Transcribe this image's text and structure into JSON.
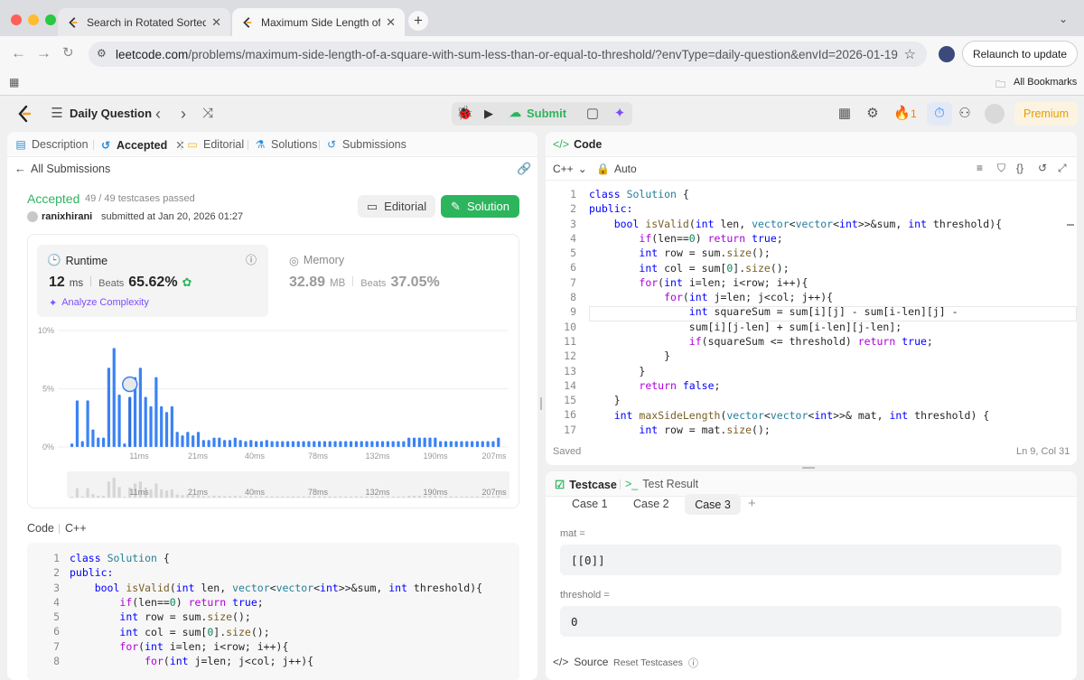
{
  "browser": {
    "tabs": [
      {
        "title": "Search in Rotated Sorted Arra"
      },
      {
        "title": "Maximum Side Length of a Sq"
      }
    ],
    "url_domain": "leetcode.com",
    "url_path": "/problems/maximum-side-length-of-a-square-with-sum-less-than-or-equal-to-threshold/?envType=daily-question&envId=2026-01-19",
    "relaunch_label": "Relaunch to update",
    "bookmarks_label": "All Bookmarks"
  },
  "topbar": {
    "title": "Daily Question",
    "submit_label": "Submit",
    "streak_count": "1",
    "premium_label": "Premium"
  },
  "left": {
    "tabs": [
      "Description",
      "Accepted",
      "Editorial",
      "Solutions",
      "Submissions"
    ],
    "back_label": "All Submissions",
    "status": "Accepted",
    "testcases": "49 / 49 testcases passed",
    "user": "ranixhirani",
    "submitted_at": "submitted at Jan 20, 2026 01:27",
    "editorial_btn": "Editorial",
    "solution_btn": "Solution",
    "runtime_label": "Runtime",
    "runtime_value": "12",
    "runtime_unit": "ms",
    "beats_label": "Beats",
    "runtime_beats": "65.62%",
    "analyze_label": "Analyze Complexity",
    "memory_label": "Memory",
    "memory_value": "32.89",
    "memory_unit": "MB",
    "memory_beats": "37.05%",
    "code_label": "Code",
    "lang_label": "C++"
  },
  "chart_data": {
    "type": "bar",
    "ylabel_ticks": [
      "10%",
      "5%",
      "0%"
    ],
    "ylim": [
      0,
      10
    ],
    "x_tick_labels": [
      "11ms",
      "21ms",
      "40ms",
      "78ms",
      "132ms",
      "190ms",
      "207ms"
    ],
    "values": [
      0.3,
      4.0,
      0.5,
      4.0,
      1.5,
      0.8,
      0.8,
      6.8,
      8.5,
      4.5,
      0.3,
      4.3,
      6.0,
      6.8,
      4.3,
      3.5,
      6.0,
      3.5,
      3.0,
      3.5,
      1.3,
      1.0,
      1.3,
      1.0,
      1.3,
      0.6,
      0.6,
      0.8,
      0.8,
      0.6,
      0.6,
      0.8,
      0.6,
      0.5,
      0.6,
      0.5,
      0.5,
      0.6,
      0.5,
      0.5,
      0.5,
      0.5,
      0.5,
      0.5,
      0.5,
      0.5,
      0.5,
      0.5,
      0.5,
      0.5,
      0.5,
      0.5,
      0.5,
      0.5,
      0.5,
      0.5,
      0.5,
      0.5,
      0.5,
      0.5,
      0.5,
      0.5,
      0.5,
      0.5,
      0.8,
      0.8,
      0.8,
      0.8,
      0.8,
      0.8,
      0.5,
      0.5,
      0.5,
      0.5,
      0.5,
      0.5,
      0.5,
      0.5,
      0.5,
      0.5,
      0.5,
      0.8
    ],
    "highlight_index": 11
  },
  "code_panel": {
    "title": "Code",
    "lang": "C++",
    "mode": "Auto",
    "status": "Saved",
    "cursor": "Ln 9, Col 31"
  },
  "code_lines": [
    "class Solution {",
    "public:",
    "    bool isValid(int len, vector<vector<int>>&sum, int threshold){",
    "        if(len==0) return true;",
    "        int row = sum.size();",
    "        int col = sum[0].size();",
    "        for(int i=len; i<row; i++){",
    "            for(int j=len; j<col; j++){",
    "                int squareSum = sum[i][j] - sum[i-len][j] -",
    "                sum[i][j-len] + sum[i-len][j-len];",
    "                if(squareSum <= threshold) return true;",
    "            }",
    "        }",
    "        return false;",
    "    }",
    "    int maxSideLength(vector<vector<int>>& mat, int threshold) {",
    "        int row = mat.size();"
  ],
  "testcase": {
    "tab_testcase": "Testcase",
    "tab_result": "Test Result",
    "cases": [
      "Case 1",
      "Case 2",
      "Case 3"
    ],
    "mat_label": "mat =",
    "mat_value": "[[0]]",
    "threshold_label": "threshold =",
    "threshold_value": "0",
    "source_label": "Source",
    "reset_label": "Reset Testcases"
  },
  "colors": {
    "accent_green": "#2db55d",
    "bar_blue": "#3b82f6",
    "accepted_green": "#2db55d"
  }
}
